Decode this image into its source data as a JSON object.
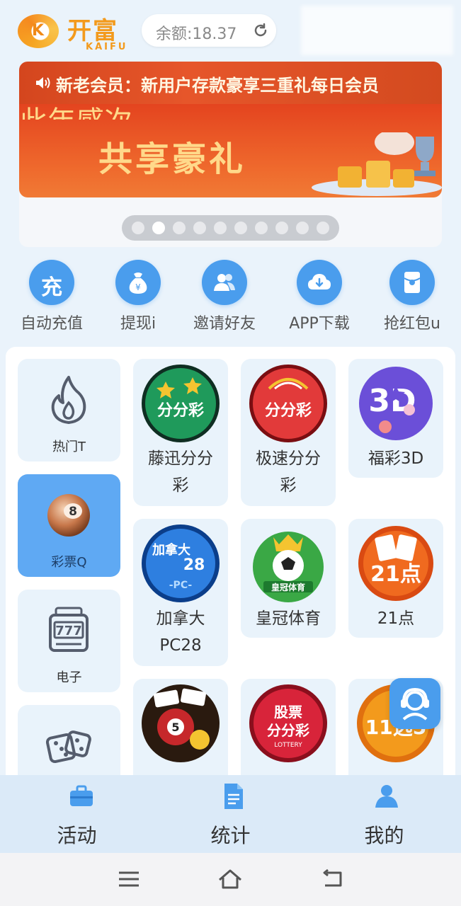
{
  "header": {
    "logo_cn": "开富",
    "logo_en": "KAIFU",
    "logo_mark": "K",
    "balance": "余额:18.37"
  },
  "banner": {
    "notice": "新老会员：新用户存款豪享三重礼每日会员",
    "title": "共享豪礼",
    "topline": "此年感次",
    "dots_total": 10,
    "dots_active_index": 1
  },
  "quick_actions": [
    {
      "label": "自动充值",
      "icon": "recharge-icon",
      "glyph": "充"
    },
    {
      "label": "提现i",
      "icon": "money-bag-icon"
    },
    {
      "label": "邀请好友",
      "icon": "invite-friends-icon"
    },
    {
      "label": "APP下载",
      "icon": "cloud-download-icon"
    },
    {
      "label": "抢红包u",
      "icon": "red-envelope-icon"
    }
  ],
  "categories": [
    {
      "label": "热门T",
      "icon": "flame-icon",
      "active": false
    },
    {
      "label": "彩票Q",
      "icon": "lottery-ball-icon",
      "active": true
    },
    {
      "label": "电子",
      "icon": "slot-machine-icon",
      "active": false
    },
    {
      "label": "",
      "icon": "dice-icon",
      "active": false
    }
  ],
  "games": [
    {
      "name": "藤迅分分彩",
      "line1": "藤迅分分",
      "line2": "彩",
      "icon_text": "分分彩",
      "color": "#1f9a5b"
    },
    {
      "name": "极速分分彩",
      "line1": "极速分分",
      "line2": "彩",
      "icon_text": "分分彩",
      "color": "#e23a3a"
    },
    {
      "name": "福彩3D",
      "line1": "福彩3D",
      "line2": "",
      "icon_text": "3D",
      "color": "#6b4fd8"
    },
    {
      "name": "加拿大PC28",
      "line1": "加拿大",
      "line2": "PC28",
      "icon_text": "加拿大",
      "color": "#2e7fe0"
    },
    {
      "name": "皇冠体育",
      "line1": "皇冠体育",
      "line2": "",
      "icon_text": "皇冠体育",
      "color": "#3aa845"
    },
    {
      "name": "21点",
      "line1": "21点",
      "line2": "",
      "icon_text": "21点",
      "color": "#f06a1f"
    },
    {
      "name": "",
      "line1": "",
      "line2": "",
      "icon_text": "LOTTERY",
      "color": "#c6282b"
    },
    {
      "name": "",
      "line1": "",
      "line2": "",
      "icon_text": "股票分分彩",
      "color": "#d8243a"
    },
    {
      "name": "",
      "line1": "",
      "line2": "",
      "icon_text": "11选5",
      "color": "#f39a1c"
    }
  ],
  "bottom_nav": [
    {
      "label": "活动",
      "icon": "briefcase-icon"
    },
    {
      "label": "统计",
      "icon": "document-icon"
    },
    {
      "label": "我的",
      "icon": "user-icon"
    }
  ],
  "colors": {
    "primary": "#4a9ded",
    "brand_orange": "#f39a1c",
    "banner_red": "#e4441f"
  }
}
